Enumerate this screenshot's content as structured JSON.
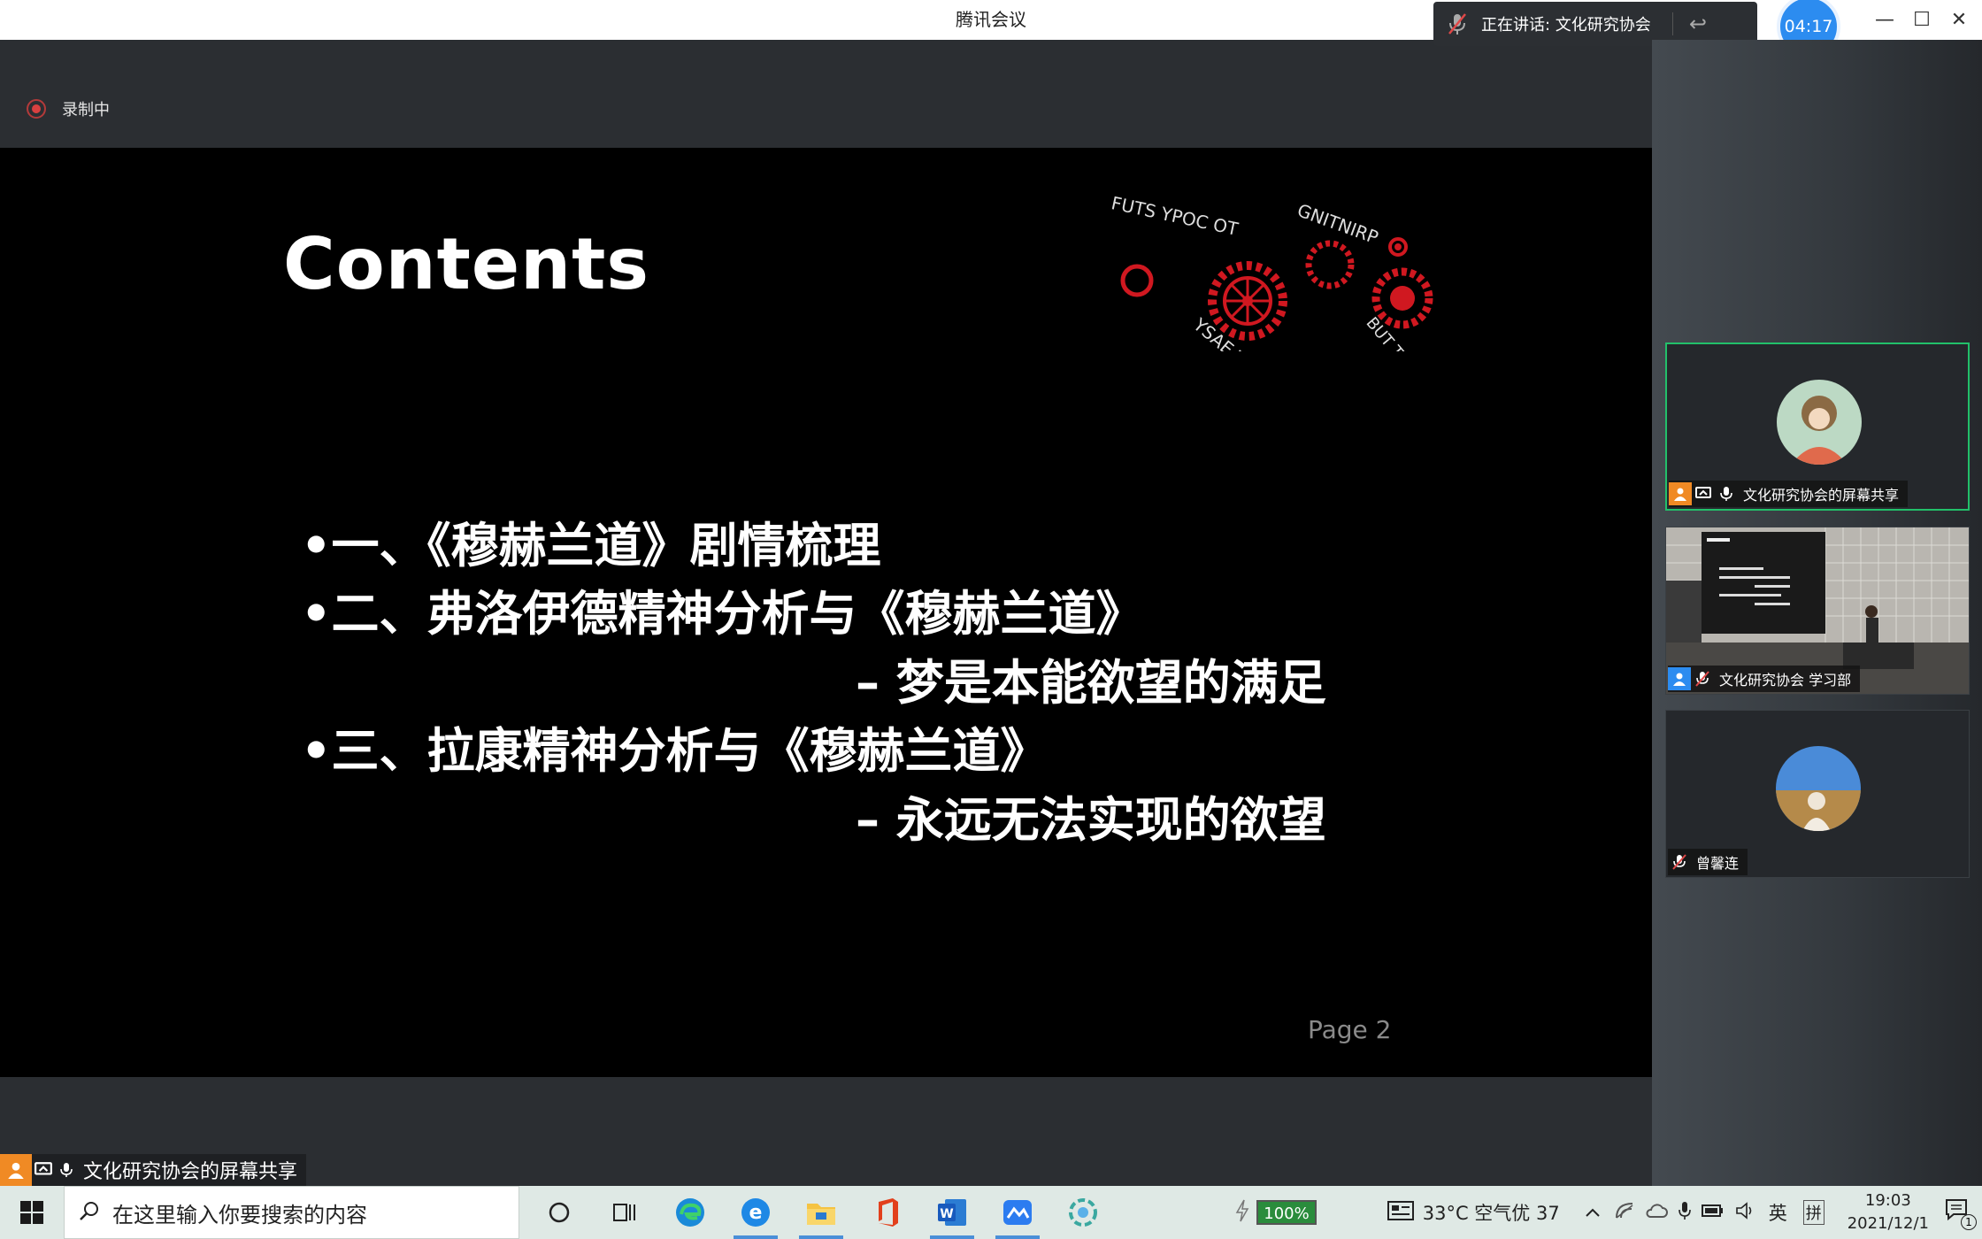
{
  "window": {
    "title": "腾讯会议",
    "minimize": "—",
    "maximize": "☐",
    "close": "✕"
  },
  "speaking": {
    "label": "正在讲话: 文化研究协会",
    "back_icon": "reply-icon"
  },
  "timer": "04:17",
  "recording": {
    "label": "录制中"
  },
  "slide": {
    "title": "Contents",
    "gears_text": [
      "BUT THEN THE PRINTING PRESS MADE IT EASY TO COPY STUFF"
    ],
    "bullets": [
      "•一、《穆赫兰道》剧情梳理",
      "•二、弗洛伊德精神分析与《穆赫兰道》",
      "– 梦是本能欲望的满足",
      "•三、拉康精神分析与《穆赫兰道》",
      "– 永远无法实现的欲望"
    ],
    "page": "Page 2"
  },
  "participants": [
    {
      "name": "文化研究协会的屏幕共享",
      "active": true
    },
    {
      "name": "文化研究协会 学习部",
      "active": false
    },
    {
      "name": "曾馨连",
      "active": false
    }
  ],
  "share_label": "文化研究协会的屏幕共享",
  "taskbar": {
    "search_placeholder": "在这里输入你要搜索的内容",
    "battery": "100%",
    "weather": "33°C  空气优 37",
    "ime": "英",
    "ime2": "拼",
    "time": "19:03",
    "date": "2021/12/1",
    "notifications": "1"
  },
  "colors": {
    "accent_blue": "#2c8cf0",
    "active_border": "#22c06a",
    "gear_red": "#d01820"
  }
}
